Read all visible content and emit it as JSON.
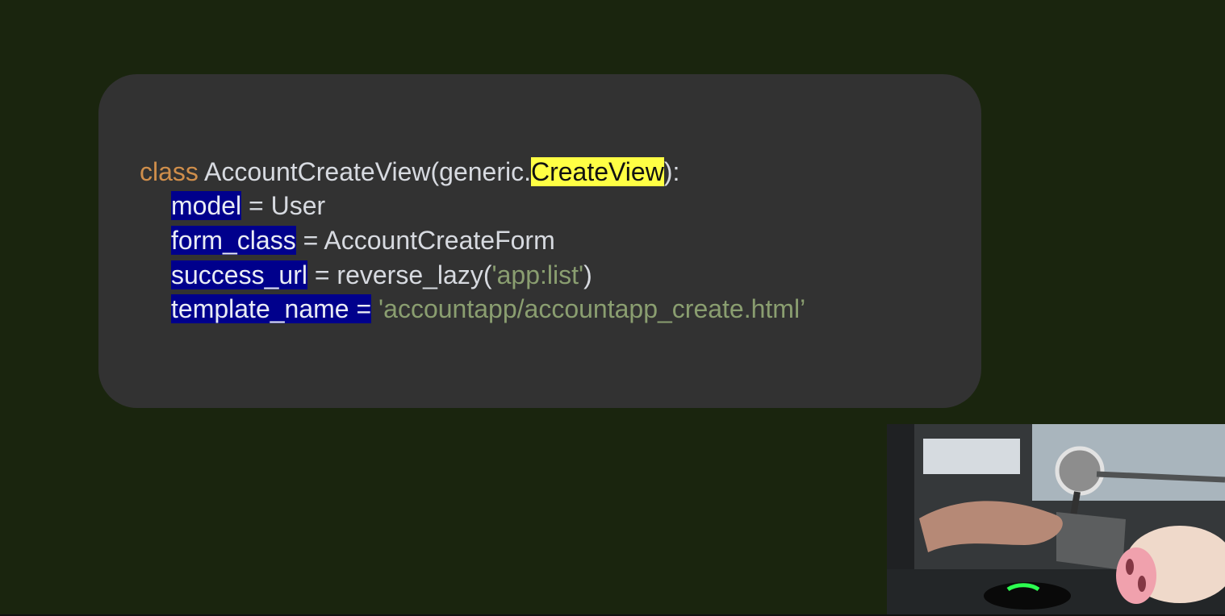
{
  "colors": {
    "background": "#1a250e",
    "card": "#323232",
    "code_text": "#d7dae0",
    "keyword": "#cf8e4b",
    "string": "#8a9e70",
    "highlight_yellow": "#ffff44",
    "highlight_blue": "#00008c"
  },
  "code": {
    "line1": {
      "keyword": "class",
      "class_name": " AccountCreateView(generic.",
      "highlighted": "CreateView",
      "tail": "):"
    },
    "line2": {
      "highlighted": "model",
      "rest": " = User"
    },
    "line3": {
      "highlighted": "form_class",
      "rest": " = AccountCreateForm"
    },
    "line4": {
      "highlighted": "success_url",
      "middle": " = reverse_lazy(",
      "string": "'app:list'",
      "tail": ")"
    },
    "line5": {
      "highlighted": "template_name =",
      "space": " ",
      "string": "'accountapp/accountapp_create.html’"
    }
  },
  "webcam": {
    "icon": "webcam-video-thumbnail"
  }
}
